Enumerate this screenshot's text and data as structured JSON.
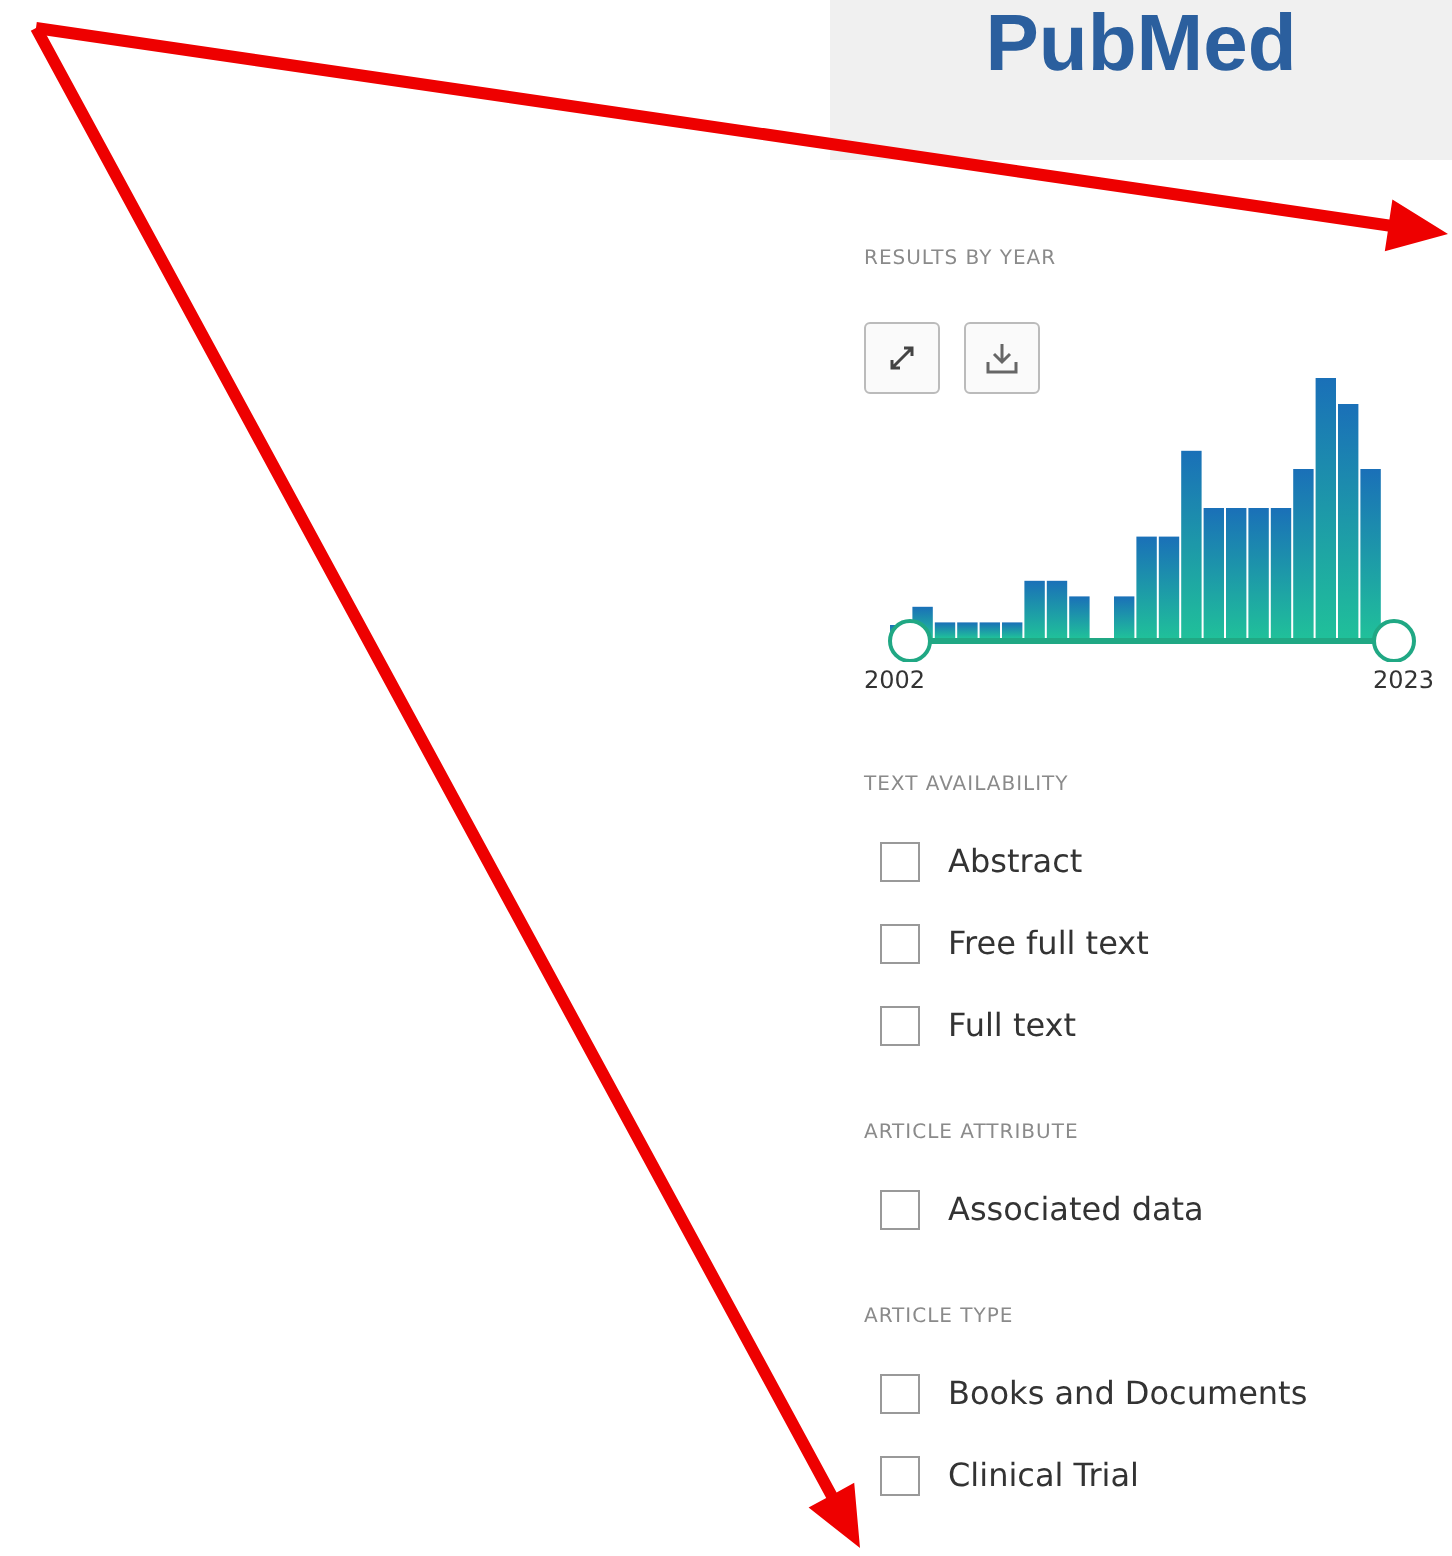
{
  "logo": {
    "text": "PubMed"
  },
  "results_by_year": {
    "title": "RESULTS BY YEAR",
    "start_label": "2002",
    "end_label": "2023"
  },
  "filter_groups": [
    {
      "title": "TEXT AVAILABILITY",
      "options": [
        {
          "label": "Abstract",
          "checked": false
        },
        {
          "label": "Free full text",
          "checked": false
        },
        {
          "label": "Full text",
          "checked": false
        }
      ]
    },
    {
      "title": "ARTICLE ATTRIBUTE",
      "options": [
        {
          "label": "Associated data",
          "checked": false
        }
      ]
    },
    {
      "title": "ARTICLE TYPE",
      "options": [
        {
          "label": "Books and Documents",
          "checked": false
        },
        {
          "label": "Clinical Trial",
          "checked": false
        }
      ]
    }
  ]
}
